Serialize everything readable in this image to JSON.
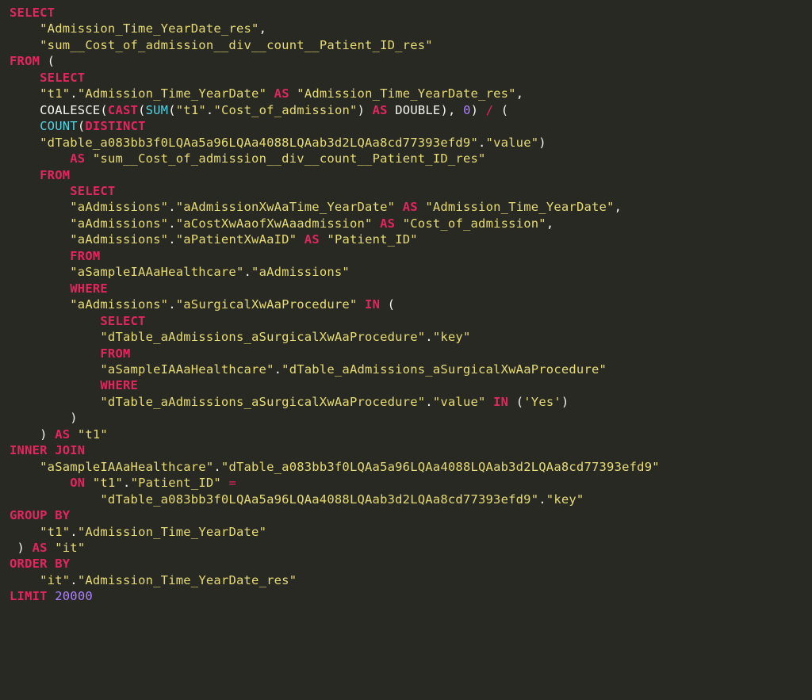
{
  "code": {
    "lines": [
      [
        {
          "cls": "kw",
          "t": "SELECT"
        }
      ],
      [
        {
          "cls": "plain",
          "t": "    "
        },
        {
          "cls": "str",
          "t": "\"Admission_Time_YearDate_res\""
        },
        {
          "cls": "plain",
          "t": ","
        }
      ],
      [
        {
          "cls": "plain",
          "t": "    "
        },
        {
          "cls": "str",
          "t": "\"sum__Cost_of_admission__div__count__Patient_ID_res\""
        }
      ],
      [
        {
          "cls": "kw",
          "t": "FROM"
        },
        {
          "cls": "plain",
          "t": " ("
        }
      ],
      [
        {
          "cls": "plain",
          "t": "    "
        },
        {
          "cls": "kw",
          "t": "SELECT"
        }
      ],
      [
        {
          "cls": "plain",
          "t": "    "
        },
        {
          "cls": "str",
          "t": "\"t1\""
        },
        {
          "cls": "plain",
          "t": "."
        },
        {
          "cls": "str",
          "t": "\"Admission_Time_YearDate\""
        },
        {
          "cls": "plain",
          "t": " "
        },
        {
          "cls": "kw",
          "t": "AS"
        },
        {
          "cls": "plain",
          "t": " "
        },
        {
          "cls": "str",
          "t": "\"Admission_Time_YearDate_res\""
        },
        {
          "cls": "plain",
          "t": ","
        }
      ],
      [
        {
          "cls": "plain",
          "t": "    COALESCE("
        },
        {
          "cls": "kw",
          "t": "CAST"
        },
        {
          "cls": "plain",
          "t": "("
        },
        {
          "cls": "fn",
          "t": "SUM"
        },
        {
          "cls": "plain",
          "t": "("
        },
        {
          "cls": "str",
          "t": "\"t1\""
        },
        {
          "cls": "plain",
          "t": "."
        },
        {
          "cls": "str",
          "t": "\"Cost_of_admission\""
        },
        {
          "cls": "plain",
          "t": ") "
        },
        {
          "cls": "kw",
          "t": "AS"
        },
        {
          "cls": "plain",
          "t": " "
        },
        {
          "cls": "plain",
          "t": "DOUBLE), "
        },
        {
          "cls": "num",
          "t": "0"
        },
        {
          "cls": "plain",
          "t": ") "
        },
        {
          "cls": "op",
          "t": "/"
        },
        {
          "cls": "plain",
          "t": " ("
        }
      ],
      [
        {
          "cls": "plain",
          "t": "    "
        },
        {
          "cls": "fn",
          "t": "COUNT"
        },
        {
          "cls": "plain",
          "t": "("
        },
        {
          "cls": "kw",
          "t": "DISTINCT"
        }
      ],
      [
        {
          "cls": "plain",
          "t": "    "
        },
        {
          "cls": "str",
          "t": "\"dTable_a083bb3f0LQAa5a96LQAa4088LQAab3d2LQAa8cd77393efd9\""
        },
        {
          "cls": "plain",
          "t": "."
        },
        {
          "cls": "str",
          "t": "\"value\""
        },
        {
          "cls": "plain",
          "t": ")"
        }
      ],
      [
        {
          "cls": "plain",
          "t": "        "
        },
        {
          "cls": "kw",
          "t": "AS"
        },
        {
          "cls": "plain",
          "t": " "
        },
        {
          "cls": "str",
          "t": "\"sum__Cost_of_admission__div__count__Patient_ID_res\""
        }
      ],
      [
        {
          "cls": "plain",
          "t": "    "
        },
        {
          "cls": "kw",
          "t": "FROM"
        }
      ],
      [
        {
          "cls": "plain",
          "t": "        "
        },
        {
          "cls": "kw",
          "t": "SELECT"
        }
      ],
      [
        {
          "cls": "plain",
          "t": "        "
        },
        {
          "cls": "str",
          "t": "\"aAdmissions\""
        },
        {
          "cls": "plain",
          "t": "."
        },
        {
          "cls": "str",
          "t": "\"aAdmissionXwAaTime_YearDate\""
        },
        {
          "cls": "plain",
          "t": " "
        },
        {
          "cls": "kw",
          "t": "AS"
        },
        {
          "cls": "plain",
          "t": " "
        },
        {
          "cls": "str",
          "t": "\"Admission_Time_YearDate\""
        },
        {
          "cls": "plain",
          "t": ","
        }
      ],
      [
        {
          "cls": "plain",
          "t": "        "
        },
        {
          "cls": "str",
          "t": "\"aAdmissions\""
        },
        {
          "cls": "plain",
          "t": "."
        },
        {
          "cls": "str",
          "t": "\"aCostXwAaofXwAaadmission\""
        },
        {
          "cls": "plain",
          "t": " "
        },
        {
          "cls": "kw",
          "t": "AS"
        },
        {
          "cls": "plain",
          "t": " "
        },
        {
          "cls": "str",
          "t": "\"Cost_of_admission\""
        },
        {
          "cls": "plain",
          "t": ","
        }
      ],
      [
        {
          "cls": "plain",
          "t": "        "
        },
        {
          "cls": "str",
          "t": "\"aAdmissions\""
        },
        {
          "cls": "plain",
          "t": "."
        },
        {
          "cls": "str",
          "t": "\"aPatientXwAaID\""
        },
        {
          "cls": "plain",
          "t": " "
        },
        {
          "cls": "kw",
          "t": "AS"
        },
        {
          "cls": "plain",
          "t": " "
        },
        {
          "cls": "str",
          "t": "\"Patient_ID\""
        }
      ],
      [
        {
          "cls": "plain",
          "t": "        "
        },
        {
          "cls": "kw",
          "t": "FROM"
        }
      ],
      [
        {
          "cls": "plain",
          "t": "        "
        },
        {
          "cls": "str",
          "t": "\"aSampleIAAaHealthcare\""
        },
        {
          "cls": "plain",
          "t": "."
        },
        {
          "cls": "str",
          "t": "\"aAdmissions\""
        }
      ],
      [
        {
          "cls": "plain",
          "t": "        "
        },
        {
          "cls": "kw",
          "t": "WHERE"
        }
      ],
      [
        {
          "cls": "plain",
          "t": "        "
        },
        {
          "cls": "str",
          "t": "\"aAdmissions\""
        },
        {
          "cls": "plain",
          "t": "."
        },
        {
          "cls": "str",
          "t": "\"aSurgicalXwAaProcedure\""
        },
        {
          "cls": "plain",
          "t": " "
        },
        {
          "cls": "kw",
          "t": "IN"
        },
        {
          "cls": "plain",
          "t": " ("
        }
      ],
      [
        {
          "cls": "plain",
          "t": "            "
        },
        {
          "cls": "kw",
          "t": "SELECT"
        }
      ],
      [
        {
          "cls": "plain",
          "t": "            "
        },
        {
          "cls": "str",
          "t": "\"dTable_aAdmissions_aSurgicalXwAaProcedure\""
        },
        {
          "cls": "plain",
          "t": "."
        },
        {
          "cls": "str",
          "t": "\"key\""
        }
      ],
      [
        {
          "cls": "plain",
          "t": "            "
        },
        {
          "cls": "kw",
          "t": "FROM"
        }
      ],
      [
        {
          "cls": "plain",
          "t": "            "
        },
        {
          "cls": "str",
          "t": "\"aSampleIAAaHealthcare\""
        },
        {
          "cls": "plain",
          "t": "."
        },
        {
          "cls": "str",
          "t": "\"dTable_aAdmissions_aSurgicalXwAaProcedure\""
        }
      ],
      [
        {
          "cls": "plain",
          "t": "            "
        },
        {
          "cls": "kw",
          "t": "WHERE"
        }
      ],
      [
        {
          "cls": "plain",
          "t": "            "
        },
        {
          "cls": "str",
          "t": "\"dTable_aAdmissions_aSurgicalXwAaProcedure\""
        },
        {
          "cls": "plain",
          "t": "."
        },
        {
          "cls": "str",
          "t": "\"value\""
        },
        {
          "cls": "plain",
          "t": " "
        },
        {
          "cls": "kw",
          "t": "IN"
        },
        {
          "cls": "plain",
          "t": " ("
        },
        {
          "cls": "str",
          "t": "'Yes'"
        },
        {
          "cls": "plain",
          "t": ")"
        }
      ],
      [
        {
          "cls": "plain",
          "t": "        )"
        }
      ],
      [
        {
          "cls": "plain",
          "t": "    ) "
        },
        {
          "cls": "kw",
          "t": "AS"
        },
        {
          "cls": "plain",
          "t": " "
        },
        {
          "cls": "str",
          "t": "\"t1\""
        }
      ],
      [
        {
          "cls": "kw",
          "t": "INNER JOIN"
        }
      ],
      [
        {
          "cls": "plain",
          "t": "    "
        },
        {
          "cls": "str",
          "t": "\"aSampleIAAaHealthcare\""
        },
        {
          "cls": "plain",
          "t": "."
        },
        {
          "cls": "str",
          "t": "\"dTable_a083bb3f0LQAa5a96LQAa4088LQAab3d2LQAa8cd77393efd9\""
        }
      ],
      [
        {
          "cls": "plain",
          "t": "        "
        },
        {
          "cls": "kw",
          "t": "ON"
        },
        {
          "cls": "plain",
          "t": " "
        },
        {
          "cls": "str",
          "t": "\"t1\""
        },
        {
          "cls": "plain",
          "t": "."
        },
        {
          "cls": "str",
          "t": "\"Patient_ID\""
        },
        {
          "cls": "plain",
          "t": " "
        },
        {
          "cls": "op",
          "t": "="
        }
      ],
      [
        {
          "cls": "plain",
          "t": "            "
        },
        {
          "cls": "str",
          "t": "\"dTable_a083bb3f0LQAa5a96LQAa4088LQAab3d2LQAa8cd77393efd9\""
        },
        {
          "cls": "plain",
          "t": "."
        },
        {
          "cls": "str",
          "t": "\"key\""
        }
      ],
      [
        {
          "cls": "kw",
          "t": "GROUP BY"
        }
      ],
      [
        {
          "cls": "plain",
          "t": "    "
        },
        {
          "cls": "str",
          "t": "\"t1\""
        },
        {
          "cls": "plain",
          "t": "."
        },
        {
          "cls": "str",
          "t": "\"Admission_Time_YearDate\""
        }
      ],
      [
        {
          "cls": "plain",
          "t": " ) "
        },
        {
          "cls": "kw",
          "t": "AS"
        },
        {
          "cls": "plain",
          "t": " "
        },
        {
          "cls": "str",
          "t": "\"it\""
        }
      ],
      [
        {
          "cls": "kw",
          "t": "ORDER BY"
        }
      ],
      [
        {
          "cls": "plain",
          "t": "    "
        },
        {
          "cls": "str",
          "t": "\"it\""
        },
        {
          "cls": "plain",
          "t": "."
        },
        {
          "cls": "str",
          "t": "\"Admission_Time_YearDate_res\""
        }
      ],
      [
        {
          "cls": "kw",
          "t": "LIMIT"
        },
        {
          "cls": "plain",
          "t": " "
        },
        {
          "cls": "num",
          "t": "20000"
        }
      ]
    ]
  }
}
